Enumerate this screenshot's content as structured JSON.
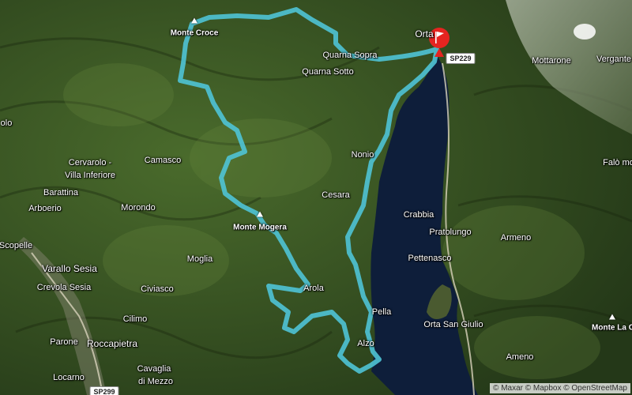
{
  "map": {
    "places": [
      {
        "name": "Orta",
        "kind": "place",
        "big": true
      },
      {
        "name": "Quarna Sopra",
        "kind": "place"
      },
      {
        "name": "Quarna Sotto",
        "kind": "place"
      },
      {
        "name": "Mottarone",
        "kind": "place"
      },
      {
        "name": "Vergante",
        "kind": "place"
      },
      {
        "name": "Nonio",
        "kind": "place"
      },
      {
        "name": "Cesara",
        "kind": "place"
      },
      {
        "name": "Crabbia",
        "kind": "place"
      },
      {
        "name": "Pratolungo",
        "kind": "place"
      },
      {
        "name": "Armeno",
        "kind": "place"
      },
      {
        "name": "Pettenasco",
        "kind": "place"
      },
      {
        "name": "Orta San Giulio",
        "kind": "place"
      },
      {
        "name": "Pella",
        "kind": "place"
      },
      {
        "name": "Alzo",
        "kind": "place"
      },
      {
        "name": "Ameno",
        "kind": "place"
      },
      {
        "name": "Arola",
        "kind": "place"
      },
      {
        "name": "Camasco",
        "kind": "place"
      },
      {
        "name": "Cervarolo -",
        "kind": "place"
      },
      {
        "name": "Villa Inferiore",
        "kind": "place"
      },
      {
        "name": "Barattina",
        "kind": "place"
      },
      {
        "name": "Arboerio",
        "kind": "place"
      },
      {
        "name": "Morondo",
        "kind": "place"
      },
      {
        "name": "Scopelle",
        "kind": "place"
      },
      {
        "name": "Varallo Sesia",
        "kind": "place",
        "big": true
      },
      {
        "name": "Crevola Sesia",
        "kind": "place"
      },
      {
        "name": "Civiasco",
        "kind": "place"
      },
      {
        "name": "Moglia",
        "kind": "place"
      },
      {
        "name": "Cilimo",
        "kind": "place"
      },
      {
        "name": "Parone",
        "kind": "place"
      },
      {
        "name": "Roccapietra",
        "kind": "place",
        "big": true
      },
      {
        "name": "Cavaglia",
        "kind": "place"
      },
      {
        "name": "di Mezzo",
        "kind": "place"
      },
      {
        "name": "Locarno",
        "kind": "place"
      },
      {
        "name": "olo",
        "kind": "place"
      },
      {
        "name": "Falò mo",
        "kind": "place"
      }
    ],
    "peaks": [
      {
        "name": "Monte Croce"
      },
      {
        "name": "Monte Mogera"
      },
      {
        "name": "Monte La C"
      }
    ],
    "roads": [
      {
        "label": "SP229"
      },
      {
        "label": "SP299"
      }
    ],
    "attribution": "© Maxar © Mapbox © OpenStreetMap",
    "colors": {
      "route": "#4fc3d6",
      "lake": "#0e1e3a",
      "flag": "#e52420"
    }
  }
}
